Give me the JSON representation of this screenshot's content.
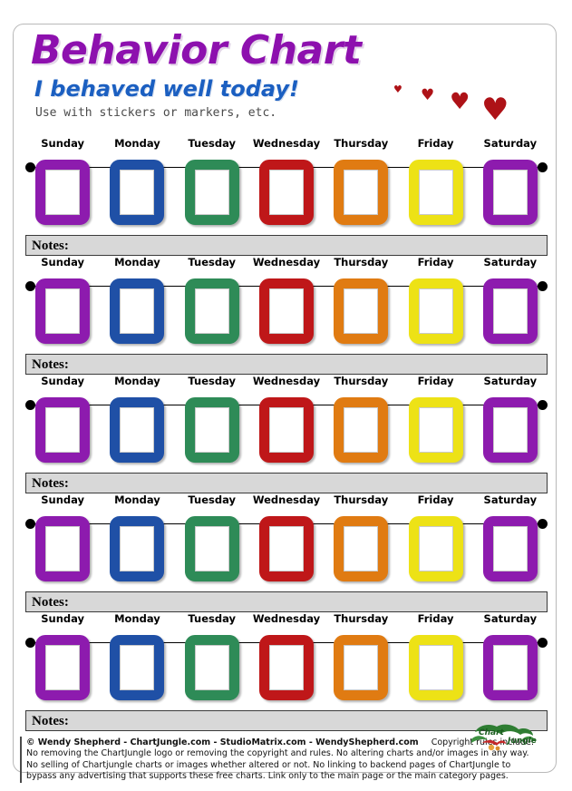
{
  "header": {
    "title": "Behavior Chart",
    "subtitle": "I behaved well today!",
    "use_note": "Use  with stickers or markers, etc.",
    "title_color": "#8D10AE",
    "subtitle_color": "#1B5FC1",
    "heart_color": "#AE1217",
    "heart_glyph": "♥",
    "hearts_count": 4
  },
  "days": [
    {
      "label": "Sunday",
      "color": "#8D1BAE"
    },
    {
      "label": "Monday",
      "color": "#1F50A6"
    },
    {
      "label": "Tuesday",
      "color": "#2E8B57"
    },
    {
      "label": "Wednesday",
      "color": "#BF1719"
    },
    {
      "label": "Thursday",
      "color": "#E07B12"
    },
    {
      "label": "Friday",
      "color": "#EDE216"
    },
    {
      "label": "Saturday",
      "color": "#8D1BAE"
    }
  ],
  "notes_label": "Notes:",
  "rows_count": 5,
  "footer": {
    "credit": "© Wendy Shepherd - ChartJungle.com - StudioMatrix.com - WendyShepherd.com",
    "copyright_rules_label": "Copyright rules include:",
    "rules_lines": [
      "No removing the ChartJungle logo or removing the copyright and rules. No altering charts and/or images in any way.",
      "No selling of Chartjungle charts or images whether altered or not. No linking to backend pages of ChartJungle to",
      "bypass any advertising that supports these free charts. Link only to the main page or the main category pages."
    ],
    "logo_alt": "Chart Jungle"
  }
}
